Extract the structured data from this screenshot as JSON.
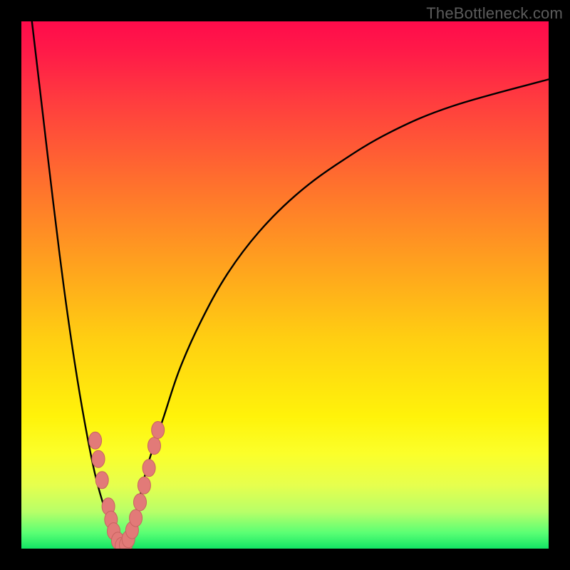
{
  "watermark": "TheBottleneck.com",
  "colors": {
    "frame": "#000000",
    "curve": "#000000",
    "marker_fill": "#e27a78",
    "marker_stroke": "#c76360",
    "gradient_top": "#ff0b4b",
    "gradient_bottom": "#13e565"
  },
  "chart_data": {
    "type": "line",
    "title": "",
    "xlabel": "",
    "ylabel": "",
    "xlim": [
      0,
      100
    ],
    "ylim": [
      0,
      100
    ],
    "grid": false,
    "legend": false,
    "series": [
      {
        "name": "left-branch",
        "x": [
          2,
          4,
          6,
          8,
          10,
          12,
          14,
          16,
          18,
          19
        ],
        "y": [
          100,
          83,
          66,
          50,
          36,
          24,
          14,
          7,
          2,
          0
        ]
      },
      {
        "name": "right-branch",
        "x": [
          19,
          20,
          22,
          24,
          27,
          30,
          34,
          39,
          45,
          52,
          60,
          70,
          82,
          100
        ],
        "y": [
          0,
          2,
          8,
          16,
          25,
          34,
          43,
          52,
          60,
          67,
          73,
          79,
          84,
          89
        ]
      }
    ],
    "markers": {
      "name": "highlight-points",
      "points": [
        {
          "x": 14.0,
          "y": 20.5
        },
        {
          "x": 14.6,
          "y": 17.0
        },
        {
          "x": 15.3,
          "y": 13.0
        },
        {
          "x": 16.5,
          "y": 8.0
        },
        {
          "x": 17.0,
          "y": 5.5
        },
        {
          "x": 17.5,
          "y": 3.3
        },
        {
          "x": 18.3,
          "y": 1.5
        },
        {
          "x": 19.0,
          "y": 0.5
        },
        {
          "x": 19.8,
          "y": 0.7
        },
        {
          "x": 20.3,
          "y": 1.8
        },
        {
          "x": 21.0,
          "y": 3.5
        },
        {
          "x": 21.7,
          "y": 5.8
        },
        {
          "x": 22.5,
          "y": 8.8
        },
        {
          "x": 23.3,
          "y": 12.0
        },
        {
          "x": 24.2,
          "y": 15.3
        },
        {
          "x": 25.2,
          "y": 19.5
        },
        {
          "x": 25.9,
          "y": 22.5
        }
      ]
    }
  }
}
